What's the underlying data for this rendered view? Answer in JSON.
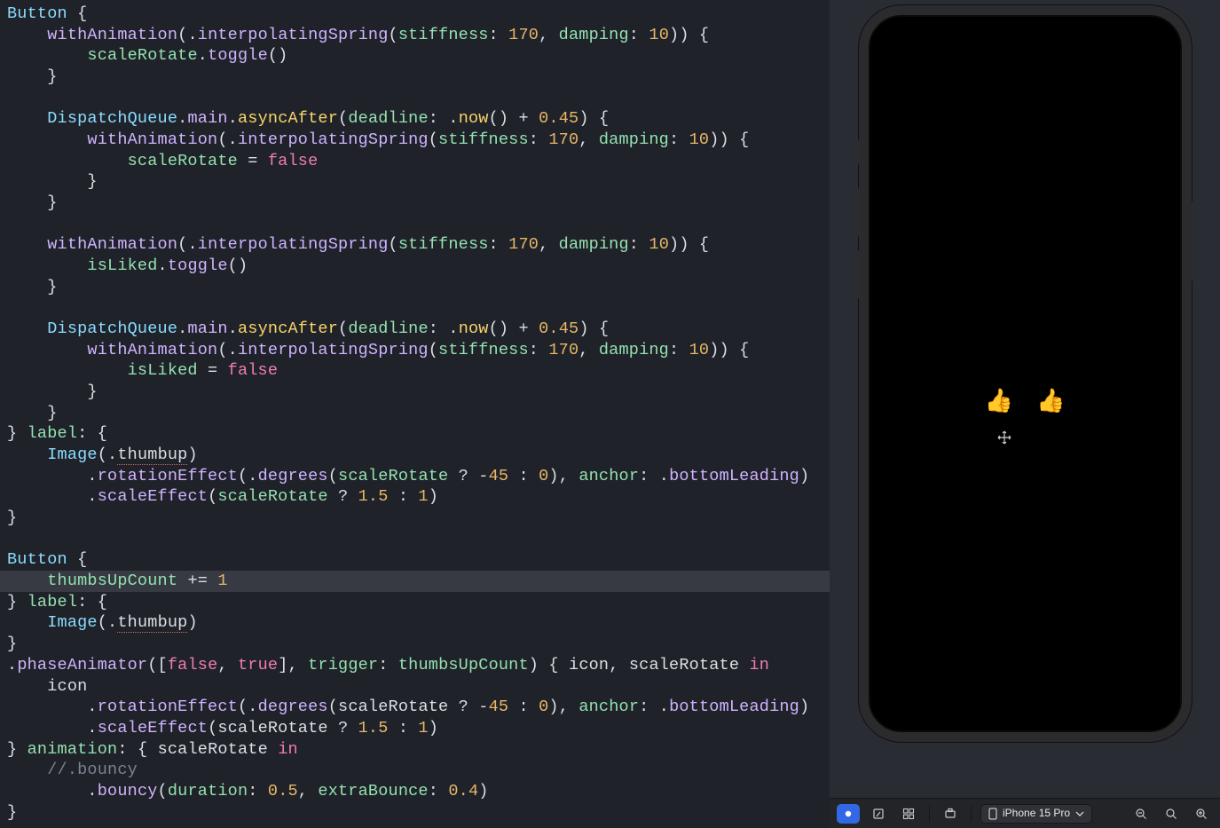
{
  "code": {
    "l1": {
      "button": "Button",
      "brace": " {"
    },
    "l2": {
      "indent": "    ",
      "fn": "withAnimation",
      "p": "(",
      "dot": ".",
      "method": "interpolatingSpring",
      "p2": "(",
      "arg1": "stiffness",
      "colon1": ": ",
      "n1": "170",
      "comma": ", ",
      "arg2": "damping",
      "colon2": ": ",
      "n2": "10",
      "p3": "))",
      "brace": " {"
    },
    "l3": {
      "indent": "        ",
      "var": "scaleRotate",
      "dot": ".",
      "fn": "toggle",
      "p": "()"
    },
    "l4": {
      "indent": "    ",
      "brace": "}"
    },
    "l5": {
      "blank": ""
    },
    "l6": {
      "indent": "    ",
      "type": "DispatchQueue",
      "dot1": ".",
      "main": "main",
      "dot2": ".",
      "fn": "asyncAfter",
      "p": "(",
      "arg": "deadline",
      "colon": ": ",
      "dot3": ".",
      "now": "now",
      "p2": "()",
      "plus": " + ",
      "n": "0.45",
      "p3": ")",
      "brace": " {"
    },
    "l7": {
      "indent": "        ",
      "fn": "withAnimation",
      "p": "(",
      "dot": ".",
      "method": "interpolatingSpring",
      "p2": "(",
      "arg1": "stiffness",
      "colon1": ": ",
      "n1": "170",
      "comma": ", ",
      "arg2": "damping",
      "colon2": ": ",
      "n2": "10",
      "p3": "))",
      "brace": " {"
    },
    "l8": {
      "indent": "            ",
      "var": "scaleRotate",
      "eq": " = ",
      "false": "false"
    },
    "l9": {
      "indent": "        ",
      "brace": "}"
    },
    "l10": {
      "indent": "    ",
      "brace": "}"
    },
    "l11": {
      "blank": ""
    },
    "l12": {
      "indent": "    ",
      "fn": "withAnimation",
      "p": "(",
      "dot": ".",
      "method": "interpolatingSpring",
      "p2": "(",
      "arg1": "stiffness",
      "colon1": ": ",
      "n1": "170",
      "comma": ", ",
      "arg2": "damping",
      "colon2": ": ",
      "n2": "10",
      "p3": "))",
      "brace": " {"
    },
    "l13": {
      "indent": "        ",
      "var": "isLiked",
      "dot": ".",
      "fn": "toggle",
      "p": "()"
    },
    "l14": {
      "indent": "    ",
      "brace": "}"
    },
    "l15": {
      "blank": ""
    },
    "l16": {
      "indent": "    ",
      "type": "DispatchQueue",
      "dot1": ".",
      "main": "main",
      "dot2": ".",
      "fn": "asyncAfter",
      "p": "(",
      "arg": "deadline",
      "colon": ": ",
      "dot3": ".",
      "now": "now",
      "p2": "()",
      "plus": " + ",
      "n": "0.45",
      "p3": ")",
      "brace": " {"
    },
    "l17": {
      "indent": "        ",
      "fn": "withAnimation",
      "p": "(",
      "dot": ".",
      "method": "interpolatingSpring",
      "p2": "(",
      "arg1": "stiffness",
      "colon1": ": ",
      "n1": "170",
      "comma": ", ",
      "arg2": "damping",
      "colon2": ": ",
      "n2": "10",
      "p3": "))",
      "brace": " {"
    },
    "l18": {
      "indent": "            ",
      "var": "isLiked",
      "eq": " = ",
      "false": "false"
    },
    "l19": {
      "indent": "        ",
      "brace": "}"
    },
    "l20": {
      "indent": "    ",
      "brace": "}"
    },
    "l21": {
      "brace1": "}",
      "sp": " ",
      "label": "label",
      "colon": ":",
      "brace2": " {"
    },
    "l22": {
      "indent": "    ",
      "type": "Image",
      "p": "(",
      "dot": ".",
      "thumb": "thumbup",
      "p2": ")"
    },
    "l23": {
      "indent": "        ",
      "dot": ".",
      "fn": "rotationEffect",
      "p": "(",
      "dot2": ".",
      "deg": "degrees",
      "p2": "(",
      "var": "scaleRotate",
      "q": " ? ",
      "neg": "-",
      "n1": "45",
      "colon": " : ",
      "n2": "0",
      "p3": ")",
      "comma": ", ",
      "arg": "anchor",
      "colon2": ": ",
      "dot3": ".",
      "val": "bottomLeading",
      "p4": ")"
    },
    "l24": {
      "indent": "        ",
      "dot": ".",
      "fn": "scaleEffect",
      "p": "(",
      "var": "scaleRotate",
      "q": " ? ",
      "n1": "1.5",
      "colon": " : ",
      "n2": "1",
      "p2": ")"
    },
    "l25": {
      "brace": "}"
    },
    "l26": {
      "blank": ""
    },
    "l27": {
      "button": "Button",
      "brace": " {"
    },
    "l28": {
      "indent": "    ",
      "var": "thumbsUpCount",
      "op": " += ",
      "n": "1"
    },
    "l29": {
      "brace1": "}",
      "sp": " ",
      "label": "label",
      "colon": ":",
      "brace2": " {"
    },
    "l30": {
      "indent": "    ",
      "type": "Image",
      "p": "(",
      "dot": ".",
      "thumb": "thumbup",
      "p2": ")"
    },
    "l31": {
      "brace": "}"
    },
    "l32": {
      "dot": ".",
      "fn": "phaseAnimator",
      "p": "([",
      "false": "false",
      "comma": ", ",
      "true": "true",
      "p2": "]",
      "comma2": ", ",
      "arg": "trigger",
      "colon": ": ",
      "var": "thumbsUpCount",
      "p3": ")",
      "brace": " { ",
      "v1": "icon",
      "comma3": ", ",
      "v2": "scaleRotate",
      "sp": " ",
      "in": "in"
    },
    "l33": {
      "indent": "    ",
      "var": "icon"
    },
    "l34": {
      "indent": "        ",
      "dot": ".",
      "fn": "rotationEffect",
      "p": "(",
      "dot2": ".",
      "deg": "degrees",
      "p2": "(",
      "var": "scaleRotate",
      "q": " ? ",
      "neg": "-",
      "n1": "45",
      "colon": " : ",
      "n2": "0",
      "p3": ")",
      "comma": ", ",
      "arg": "anchor",
      "colon2": ": ",
      "dot3": ".",
      "val": "bottomLeading",
      "p4": ")"
    },
    "l35": {
      "indent": "        ",
      "dot": ".",
      "fn": "scaleEffect",
      "p": "(",
      "var": "scaleRotate",
      "q": " ? ",
      "n1": "1.5",
      "colon": " : ",
      "n2": "1",
      "p2": ")"
    },
    "l36": {
      "brace1": "}",
      "sp": " ",
      "anim": "animation",
      "colon": ":",
      "brace2": " { ",
      "var": "scaleRotate",
      "sp2": " ",
      "in": "in"
    },
    "l37": {
      "indent": "    ",
      "comment": "//.bouncy"
    },
    "l38": {
      "indent": "        ",
      "dot": ".",
      "fn": "bouncy",
      "p": "(",
      "arg1": "duration",
      "colon1": ": ",
      "n1": "0.5",
      "comma": ", ",
      "arg2": "extraBounce",
      "colon2": ": ",
      "n2": "0.4",
      "p2": ")"
    },
    "l39": {
      "brace": "}"
    }
  },
  "preview": {
    "thumb1": "👍",
    "thumb2": "👍"
  },
  "toolbar": {
    "device": "iPhone 15 Pro"
  }
}
